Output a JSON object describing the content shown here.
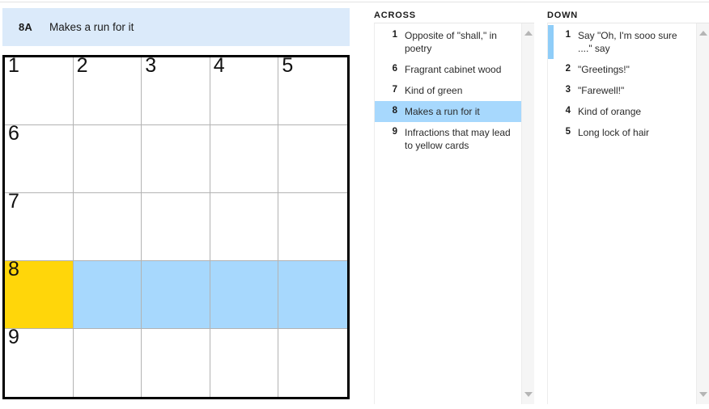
{
  "current_clue": {
    "number_label": "8A",
    "text": "Makes a run for it"
  },
  "grid": {
    "rows": 5,
    "cols": 5,
    "colors": {
      "cursor": "#ffd60a",
      "word_highlight": "#a7d8fd",
      "clue_bar": "#dbeafa",
      "border": "#000000",
      "cell_line": "#b3b3b3"
    },
    "cells": [
      {
        "number": "1",
        "letter": "",
        "state": "empty"
      },
      {
        "number": "2",
        "letter": "",
        "state": "empty"
      },
      {
        "number": "3",
        "letter": "",
        "state": "empty"
      },
      {
        "number": "4",
        "letter": "",
        "state": "empty"
      },
      {
        "number": "5",
        "letter": "",
        "state": "empty"
      },
      {
        "number": "6",
        "letter": "",
        "state": "empty"
      },
      {
        "number": "",
        "letter": "",
        "state": "empty"
      },
      {
        "number": "",
        "letter": "",
        "state": "empty"
      },
      {
        "number": "",
        "letter": "",
        "state": "empty"
      },
      {
        "number": "",
        "letter": "",
        "state": "empty"
      },
      {
        "number": "7",
        "letter": "",
        "state": "empty"
      },
      {
        "number": "",
        "letter": "",
        "state": "empty"
      },
      {
        "number": "",
        "letter": "",
        "state": "empty"
      },
      {
        "number": "",
        "letter": "",
        "state": "empty"
      },
      {
        "number": "",
        "letter": "",
        "state": "empty"
      },
      {
        "number": "8",
        "letter": "",
        "state": "cursor"
      },
      {
        "number": "",
        "letter": "",
        "state": "word"
      },
      {
        "number": "",
        "letter": "",
        "state": "word"
      },
      {
        "number": "",
        "letter": "",
        "state": "word"
      },
      {
        "number": "",
        "letter": "",
        "state": "word"
      },
      {
        "number": "9",
        "letter": "",
        "state": "empty"
      },
      {
        "number": "",
        "letter": "",
        "state": "empty"
      },
      {
        "number": "",
        "letter": "",
        "state": "empty"
      },
      {
        "number": "",
        "letter": "",
        "state": "empty"
      },
      {
        "number": "",
        "letter": "",
        "state": "empty"
      }
    ]
  },
  "across": {
    "heading": "ACROSS",
    "clues": [
      {
        "number": "1",
        "text": "Opposite of \"shall,\" in poetry",
        "state": "normal"
      },
      {
        "number": "6",
        "text": "Fragrant cabinet wood",
        "state": "normal"
      },
      {
        "number": "7",
        "text": "Kind of green",
        "state": "normal"
      },
      {
        "number": "8",
        "text": "Makes a run for it",
        "state": "selected"
      },
      {
        "number": "9",
        "text": "Infractions that may lead to yellow cards",
        "state": "normal"
      }
    ]
  },
  "down": {
    "heading": "DOWN",
    "clues": [
      {
        "number": "1",
        "text": "Say \"Oh, I'm sooo sure ....\" say",
        "state": "cross-ref"
      },
      {
        "number": "2",
        "text": "\"Greetings!\"",
        "state": "normal"
      },
      {
        "number": "3",
        "text": "\"Farewell!\"",
        "state": "normal"
      },
      {
        "number": "4",
        "text": "Kind of orange",
        "state": "normal"
      },
      {
        "number": "5",
        "text": "Long lock of hair",
        "state": "normal"
      }
    ]
  },
  "scrollbars": {
    "up_arrow_icon": "triangle-up-icon",
    "down_arrow_icon": "triangle-down-icon"
  }
}
